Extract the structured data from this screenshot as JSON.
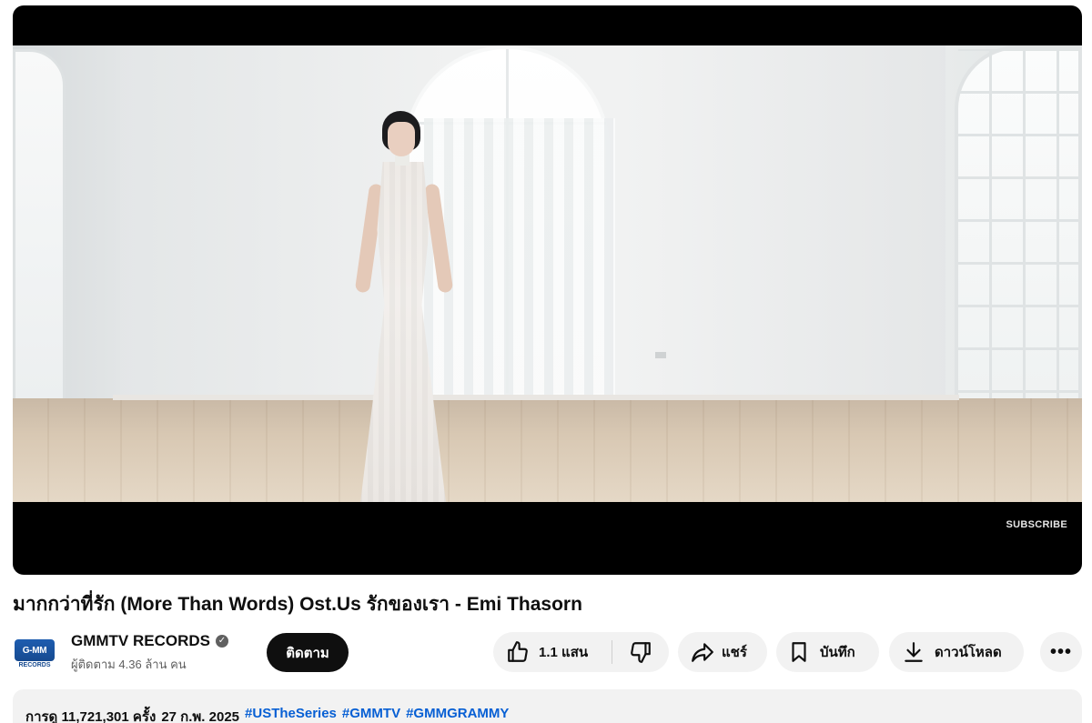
{
  "video": {
    "overlay_text": "SUBSCRIBE"
  },
  "title": "มากกว่าที่รัก (More Than Words) Ost.Us รักของเรา - Emi Thasorn",
  "channel": {
    "name": "GMMTV RECORDS",
    "logo_text": "G-MM",
    "logo_subtext": "RECORDS",
    "verified_glyph": "✓",
    "subscribers": "ผู้ติดตาม 4.36 ล้าน คน",
    "subscribe_label": "ติดตาม"
  },
  "actions": {
    "likes": "1.1 แสน",
    "share_label": "แชร์",
    "save_label": "บันทึก",
    "download_label": "ดาวน์โหลด",
    "more_glyph": "•••"
  },
  "description": {
    "views": "การดู 11,721,301 ครั้ง",
    "date": "27 ก.พ. 2025",
    "hashtags": [
      "#USTheSeries",
      "#GMMTV",
      "#GMMGRAMMY"
    ]
  },
  "colors": {
    "accent_link": "#065fd4",
    "subscribe_button": "#0f0f0f",
    "pill_background": "#f2f2f2"
  }
}
